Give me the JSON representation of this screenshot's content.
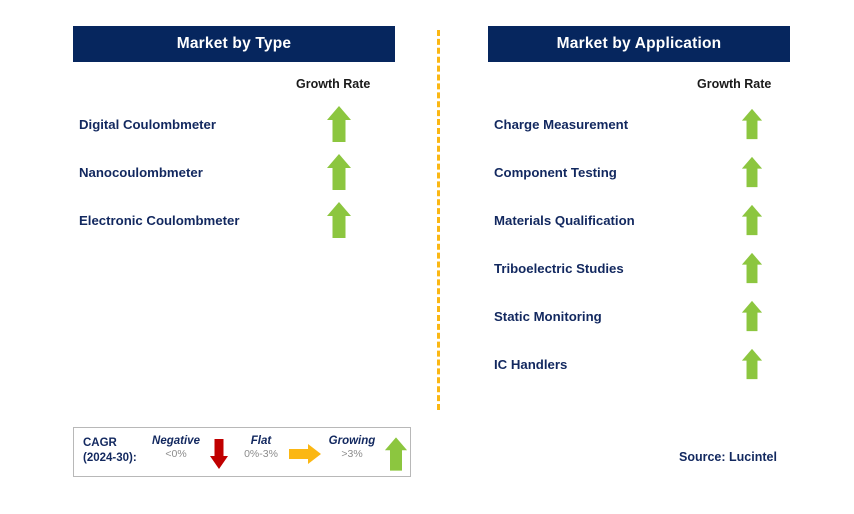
{
  "columns": {
    "left": {
      "header": "Market by Type",
      "growth_rate_label": "Growth Rate",
      "items": [
        {
          "label": "Digital Coulombmeter",
          "trend": "growing"
        },
        {
          "label": "Nanocoulombmeter",
          "trend": "growing"
        },
        {
          "label": "Electronic Coulombmeter",
          "trend": "growing"
        }
      ]
    },
    "right": {
      "header": "Market by Application",
      "growth_rate_label": "Growth Rate",
      "items": [
        {
          "label": "Charge Measurement",
          "trend": "growing"
        },
        {
          "label": "Component Testing",
          "trend": "growing"
        },
        {
          "label": "Materials Qualification",
          "trend": "growing"
        },
        {
          "label": "Triboelectric Studies",
          "trend": "growing"
        },
        {
          "label": "Static Monitoring",
          "trend": "growing"
        },
        {
          "label": "IC Handlers",
          "trend": "growing"
        }
      ]
    }
  },
  "legend": {
    "cagr_line1": "CAGR",
    "cagr_line2": "(2024-30):",
    "entries": [
      {
        "title": "Negative",
        "value": "<0%",
        "icon": "arrow-down-icon"
      },
      {
        "title": "Flat",
        "value": "0%-3%",
        "icon": "arrow-right-icon"
      },
      {
        "title": "Growing",
        "value": ">3%",
        "icon": "arrow-up-icon"
      }
    ]
  },
  "source": "Source: Lucintel",
  "colors": {
    "navy": "#06265e",
    "navy_text": "#12285f",
    "green": "#8cc63f",
    "red": "#c00000",
    "orange": "#fbb713",
    "gray_value": "#8c8c8c",
    "legend_border": "#b8b8b8"
  }
}
